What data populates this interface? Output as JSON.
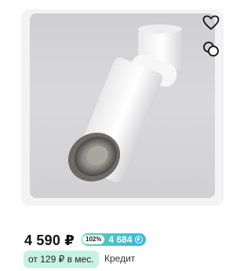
{
  "product": {
    "price": "4 590 ₽",
    "bonus": {
      "percent": "102%",
      "amount": "4 684"
    },
    "installment": "от 129 ₽ в мес.",
    "credit": "Кредит"
  },
  "icons": {
    "favorite": "heart-icon",
    "compare": "compare-icon"
  },
  "colors": {
    "badge_gradient_start": "#57d1b2",
    "badge_gradient_end": "#37b7e0",
    "installment_bg": "#c6f2e3"
  }
}
